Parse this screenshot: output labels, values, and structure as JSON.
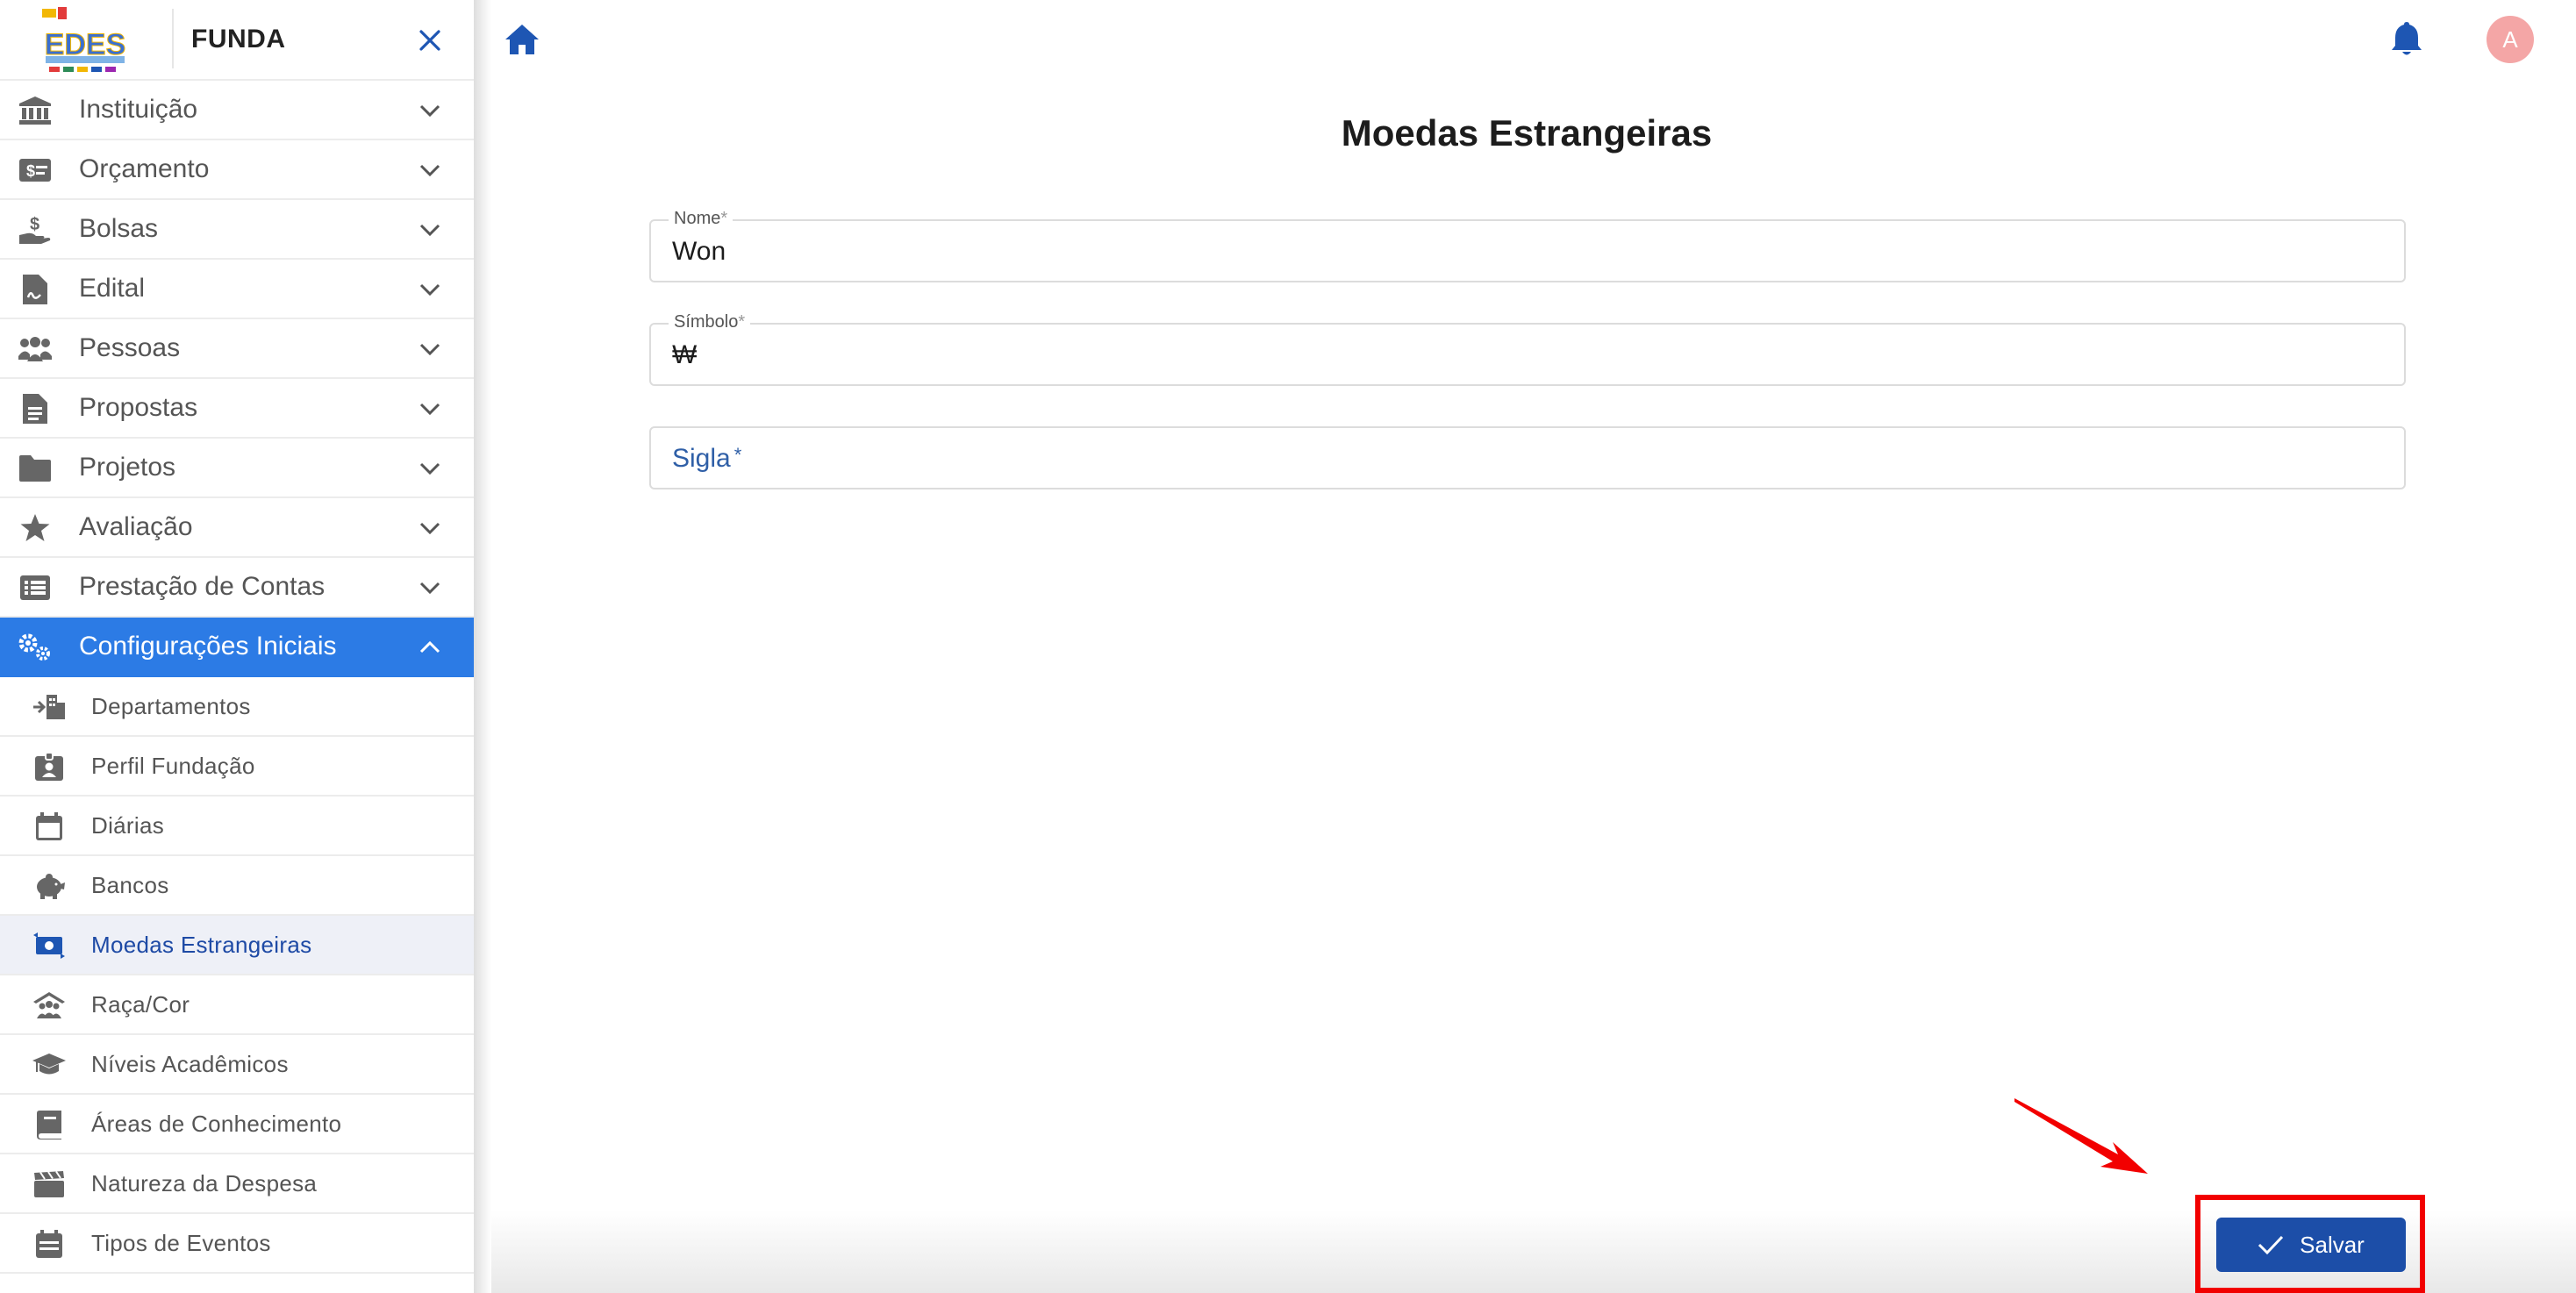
{
  "sidebar": {
    "app_name": "FUNDA",
    "logo_text": "EDES",
    "menu": [
      {
        "label": "Instituição",
        "icon": "bank-icon"
      },
      {
        "label": "Orçamento",
        "icon": "money-check-icon"
      },
      {
        "label": "Bolsas",
        "icon": "hand-coin-icon"
      },
      {
        "label": "Edital",
        "icon": "file-contract-icon"
      },
      {
        "label": "Pessoas",
        "icon": "users-icon"
      },
      {
        "label": "Propostas",
        "icon": "file-lines-icon"
      },
      {
        "label": "Projetos",
        "icon": "folder-icon"
      },
      {
        "label": "Avaliação",
        "icon": "star-icon"
      },
      {
        "label": "Prestação de Contas",
        "icon": "list-icon"
      },
      {
        "label": "Configurações Iniciais",
        "icon": "gears-icon",
        "expanded": true
      }
    ],
    "submenu": [
      {
        "label": "Departamentos",
        "icon": "building-arrow-icon"
      },
      {
        "label": "Perfil Fundação",
        "icon": "id-badge-icon"
      },
      {
        "label": "Diárias",
        "icon": "calendar-icon"
      },
      {
        "label": "Bancos",
        "icon": "piggy-bank-icon"
      },
      {
        "label": "Moedas Estrangeiras",
        "icon": "money-exchange-icon",
        "selected": true
      },
      {
        "label": "Raça/Cor",
        "icon": "people-roof-icon"
      },
      {
        "label": "Níveis Acadêmicos",
        "icon": "graduation-cap-icon"
      },
      {
        "label": "Áreas de Conhecimento",
        "icon": "book-icon"
      },
      {
        "label": "Natureza da Despesa",
        "icon": "clapperboard-icon"
      },
      {
        "label": "Tipos de Eventos",
        "icon": "calendar-list-icon"
      }
    ]
  },
  "topbar": {
    "avatar_initial": "A"
  },
  "form": {
    "title": "Moedas Estrangeiras",
    "fields": {
      "nome": {
        "label": "Nome",
        "required_mark": "*",
        "value": "Won"
      },
      "simbolo": {
        "label": "Símbolo",
        "required_mark": "*",
        "value": "₩"
      },
      "sigla": {
        "label": "Sigla",
        "required_mark": "*",
        "value": ""
      }
    },
    "save_label": "Salvar"
  },
  "colors": {
    "sidebar_active": "#2c7be5",
    "submenu_selected_bg": "#eef0f7",
    "submenu_selected_text": "#1e4aa5",
    "primary_button": "#1c4ea8",
    "icon_blue": "#1e56b3",
    "annotation_red": "#f20000",
    "avatar_bg": "#f4a6a6"
  }
}
